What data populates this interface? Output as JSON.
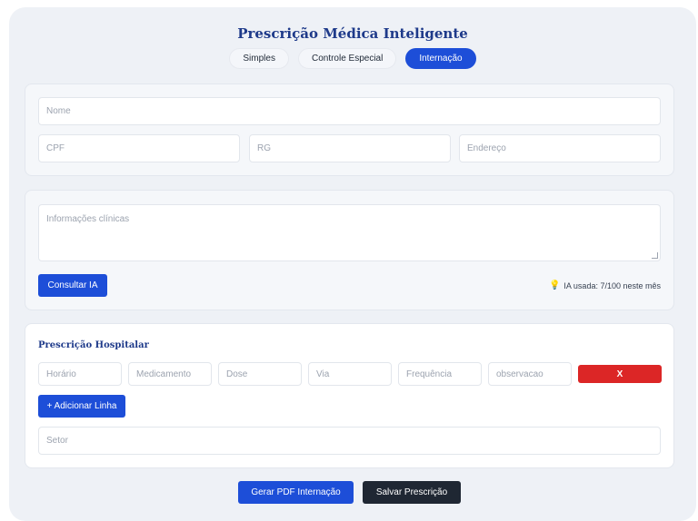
{
  "header": {
    "title": "Prescrição Médica Inteligente"
  },
  "tabs": [
    {
      "label": "Simples",
      "active": false
    },
    {
      "label": "Controle Especial",
      "active": false
    },
    {
      "label": "Internação",
      "active": true
    }
  ],
  "patient": {
    "name_placeholder": "Nome",
    "cpf_placeholder": "CPF",
    "rg_placeholder": "RG",
    "address_placeholder": "Endereço"
  },
  "clinical": {
    "info_placeholder": "Informações clínicas",
    "consult_button": "Consultar IA",
    "usage_icon": "lightbulb-icon",
    "usage_text": "IA usada: 7/100 neste mês"
  },
  "hospital": {
    "title": "Prescrição Hospitalar",
    "row": {
      "horario": "Horário",
      "medicamento": "Medicamento",
      "dose": "Dose",
      "via": "Via",
      "frequencia": "Frequência",
      "observacao": "observacao",
      "remove": "X"
    },
    "add_line": "+ Adicionar Linha",
    "setor_placeholder": "Setor"
  },
  "actions": {
    "pdf": "Gerar PDF Internação",
    "save": "Salvar Prescrição"
  },
  "colors": {
    "accent": "#1d4ed8",
    "danger": "#dc2626",
    "dark": "#1f2733",
    "title": "#1e3a8a"
  }
}
